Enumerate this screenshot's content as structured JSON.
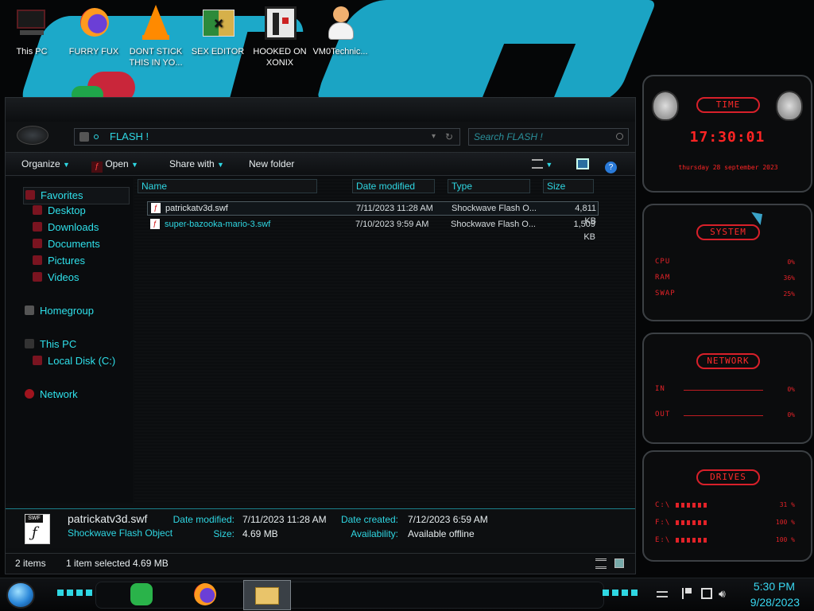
{
  "desktop": {
    "icons": [
      {
        "label": "This PC",
        "icon": "this-pc-icon"
      },
      {
        "label": "FURRY FUX",
        "icon": "firefox-icon"
      },
      {
        "label": "DONT STICK THIS IN YO...",
        "icon": "vlc-cone-icon"
      },
      {
        "label": "SEX EDITOR",
        "icon": "hxd-editor-icon"
      },
      {
        "label": "HOOKED ON XONIX",
        "icon": "xonix-game-icon"
      },
      {
        "label": "VM0Technic...",
        "icon": "doctor-avatar-icon"
      }
    ]
  },
  "explorer": {
    "address": "FLASH !",
    "search_placeholder": "Search FLASH !",
    "toolbar": {
      "organize": "Organize",
      "open": "Open",
      "share_with": "Share with",
      "new_folder": "New folder"
    },
    "nav": {
      "favorites": "Favorites",
      "desktop": "Desktop",
      "downloads": "Downloads",
      "documents": "Documents",
      "pictures": "Pictures",
      "videos": "Videos",
      "homegroup": "Homegroup",
      "this_pc": "This PC",
      "local_disk": "Local Disk (C:)",
      "network": "Network"
    },
    "columns": {
      "name": "Name",
      "date_modified": "Date modified",
      "type": "Type",
      "size": "Size"
    },
    "files": [
      {
        "name": "patrickatv3d.swf",
        "date": "7/11/2023 11:28 AM",
        "type": "Shockwave Flash O...",
        "size": "4,811 KB"
      },
      {
        "name": "super-bazooka-mario-3.swf",
        "date": "7/10/2023 9:59 AM",
        "type": "Shockwave Flash O...",
        "size": "1,509 KB"
      }
    ],
    "details": {
      "filename": "patrickatv3d.swf",
      "filetype": "Shockwave Flash Object",
      "modified_label": "Date modified:",
      "modified": "7/11/2023 11:28 AM",
      "size_label": "Size:",
      "size": "4.69 MB",
      "created_label": "Date created:",
      "created": "7/12/2023 6:59 AM",
      "availability_label": "Availability:",
      "availability": "Available offline",
      "file_icon_text": "SWF"
    },
    "status": {
      "items": "2 items",
      "selected": "1 item selected  4.69 MB"
    }
  },
  "gadgets": {
    "time": {
      "title": "TIME",
      "clock": "17:30:01",
      "date": "thursday 28 september 2023"
    },
    "system": {
      "title": "SYSTEM",
      "cpu_label": "CPU",
      "cpu": "0%",
      "ram_label": "RAM",
      "ram": "36%",
      "swap_label": "SWAP",
      "swap": "25%"
    },
    "network": {
      "title": "NETWORK",
      "in_label": "IN",
      "in": "0%",
      "out_label": "OUT",
      "out": "0%"
    },
    "drives": {
      "title": "DRIVES",
      "d1_label": "C:\\",
      "d1": "31 %",
      "d2_label": "F:\\",
      "d2": "100 %",
      "d3_label": "E:\\",
      "d3": "100 %"
    }
  },
  "taskbar": {
    "time": "5:30 PM",
    "date": "9/28/2023"
  },
  "colors": {
    "accent": "#2fd7e3",
    "gadget_red": "#e32228"
  }
}
